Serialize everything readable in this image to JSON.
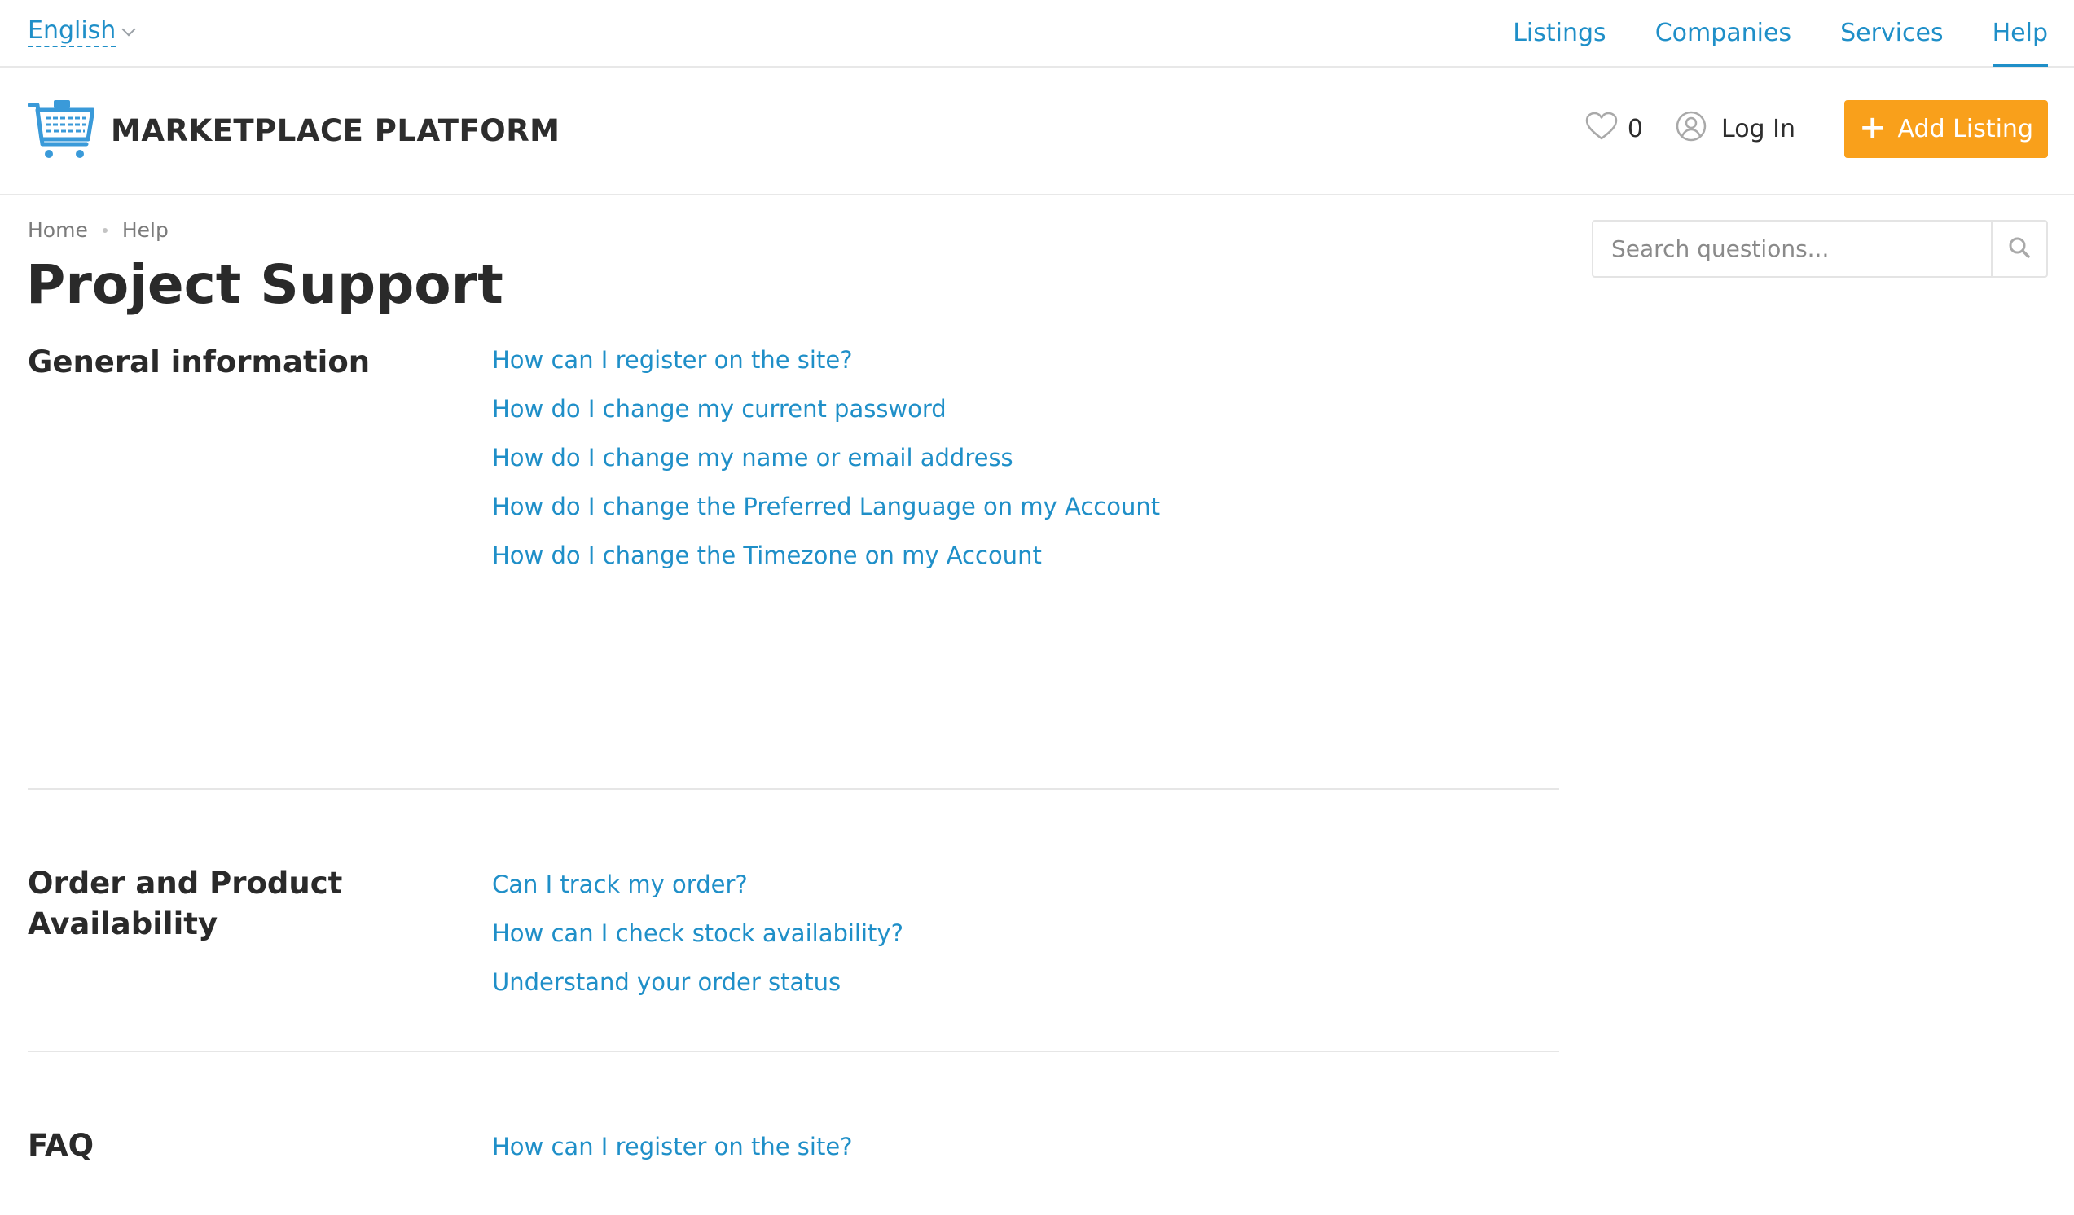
{
  "topbar": {
    "language": "English",
    "nav": [
      {
        "label": "Listings",
        "active": false
      },
      {
        "label": "Companies",
        "active": false
      },
      {
        "label": "Services",
        "active": false
      },
      {
        "label": "Help",
        "active": true
      }
    ]
  },
  "header": {
    "brand_name": "MARKETPLACE PLATFORM",
    "brand_icon": "shopping-cart-icon",
    "favorites_count": "0",
    "login_label": "Log In",
    "add_listing_label": "Add Listing",
    "add_listing_color": "#f9a01b"
  },
  "breadcrumb": [
    "Home",
    "Help"
  ],
  "page_title": "Project Support",
  "search": {
    "placeholder": "Search questions..."
  },
  "sections": [
    {
      "title": "General information",
      "questions": [
        "How can I register on the site?",
        "How do I change my current password",
        "How do I change my name or email address",
        "How do I change the Preferred Language on my Account",
        "How do I change the Timezone on my Account"
      ]
    },
    {
      "title": "Order and Product Availability",
      "questions": [
        "Can I track my order?",
        "How can I check stock availability?",
        "Understand your order status"
      ]
    },
    {
      "title": "FAQ",
      "questions": [
        "How can I register on the site?"
      ]
    }
  ],
  "colors": {
    "link": "#1f8fc8",
    "accent": "#f9a01b",
    "text": "#2a2a2a"
  }
}
